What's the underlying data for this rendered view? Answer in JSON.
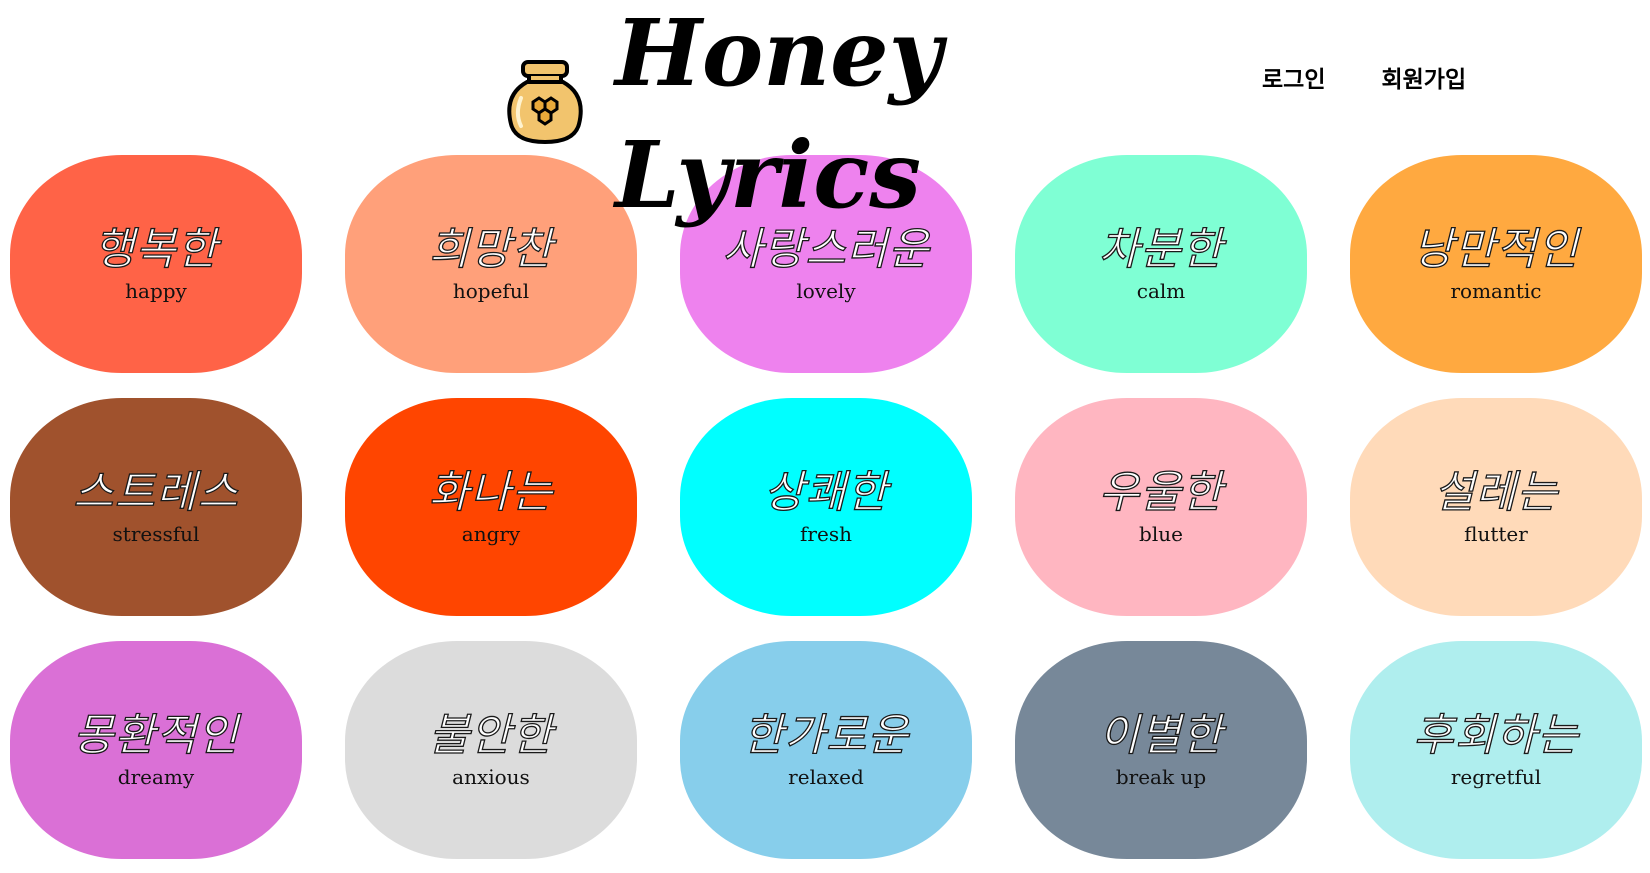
{
  "header": {
    "title_line1": "Honey",
    "title_line2": "Lyrics",
    "logo_icon": "honey-jar-icon"
  },
  "nav": {
    "login_label": "로그인",
    "signup_label": "회원가입"
  },
  "moods": [
    {
      "ko": "행복한",
      "en": "happy",
      "color": "#ff6347"
    },
    {
      "ko": "희망찬",
      "en": "hopeful",
      "color": "#ffa07a"
    },
    {
      "ko": "사랑스러운",
      "en": "lovely",
      "color": "#ee82ee"
    },
    {
      "ko": "차분한",
      "en": "calm",
      "color": "#7fffd4"
    },
    {
      "ko": "낭만적인",
      "en": "romantic",
      "color": "#ffa940"
    },
    {
      "ko": "스트레스",
      "en": "stressful",
      "color": "#a0522d"
    },
    {
      "ko": "화나는",
      "en": "angry",
      "color": "#ff4500"
    },
    {
      "ko": "상쾌한",
      "en": "fresh",
      "color": "#00ffff"
    },
    {
      "ko": "우울한",
      "en": "blue",
      "color": "#ffb6c1"
    },
    {
      "ko": "설레는",
      "en": "flutter",
      "color": "#ffdab9"
    },
    {
      "ko": "몽환적인",
      "en": "dreamy",
      "color": "#da70d6"
    },
    {
      "ko": "불안한",
      "en": "anxious",
      "color": "#dcdcdc"
    },
    {
      "ko": "한가로운",
      "en": "relaxed",
      "color": "#87ceeb"
    },
    {
      "ko": "이별한",
      "en": "break up",
      "color": "#778899"
    },
    {
      "ko": "후회하는",
      "en": "regretful",
      "color": "#afeeee"
    }
  ]
}
